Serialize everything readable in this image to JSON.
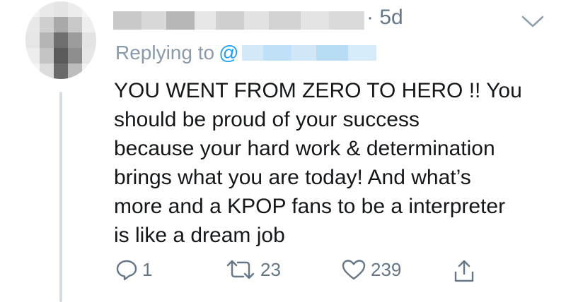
{
  "header": {
    "separator": "·",
    "time": "5d"
  },
  "reply": {
    "label": "Replying to",
    "at_symbol": "@"
  },
  "tweet": {
    "lines": [
      "YOU WENT FROM ZERO TO HERO !! You",
      "should be proud of your success",
      "because your hard work & determination",
      "brings what you are today! And what’s",
      "more and a KPOP fans to be a interpreter",
      "is like a dream job"
    ]
  },
  "actions": {
    "reply_icon": "comment-icon",
    "reply_count": "1",
    "retweet_icon": "retweet-icon",
    "retweet_count": "23",
    "like_icon": "heart-icon",
    "like_count": "239",
    "share_icon": "share-icon"
  },
  "colors": {
    "text": "#14171a",
    "muted": "#657786",
    "link": "#1da1f2"
  }
}
